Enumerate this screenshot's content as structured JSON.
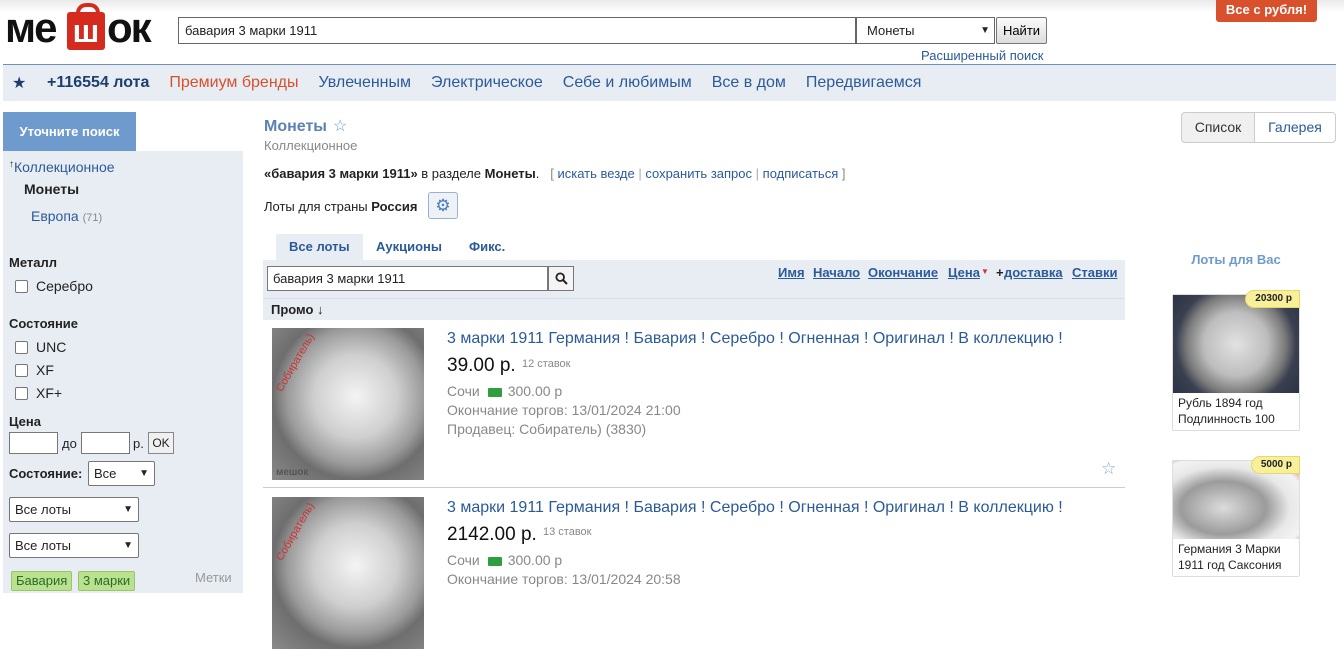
{
  "header": {
    "logo_left": "ме",
    "logo_bag": "ш",
    "logo_right": "ок",
    "search_value": "бавария 3 марки 1911",
    "category_selected": "Монеты",
    "search_button": "Найти",
    "advanced_search": "Расширенный поиск",
    "promo_badge": "Все с рубля!"
  },
  "nav": {
    "lot_count": "+116554 лота",
    "premium": "Премиум бренды",
    "items": [
      "Увлеченным",
      "Электрическое",
      "Себе и любимым",
      "Все в дом",
      "Передвигаемся"
    ]
  },
  "sidebar": {
    "refine": "Уточните поиск",
    "parent_link": "Коллекционное",
    "current": "Монеты",
    "sub_link": "Европа",
    "sub_count": "(71)",
    "metal_title": "Металл",
    "metal_silver": "Серебро",
    "condition_title": "Состояние",
    "conditions": [
      "UNC",
      "XF",
      "XF+"
    ],
    "price_title": "Цена",
    "price_to": "до",
    "price_unit": "р.",
    "price_ok": "OK",
    "condition_select_label": "Состояние:",
    "condition_select_value": "Все",
    "lots_select_1": "Все лоты",
    "lots_select_2": "Все лоты",
    "tags": [
      "Бавария",
      "3 марки"
    ],
    "tags_label": "Метки"
  },
  "main": {
    "title": "Монеты",
    "subtitle": "Коллекционное",
    "query_prefix": "«бавария 3 марки 1911»",
    "query_mid": " в разделе ",
    "query_section": "Монеты",
    "query_dot": ".",
    "links_open": "[",
    "link_everywhere": "искать везде",
    "sep": "|",
    "link_save": "сохранить запрос",
    "link_subscribe": "подписаться",
    "links_close": "]",
    "country_label": "Лоты для страны",
    "country": "Россия",
    "view_list": "Список",
    "view_gallery": "Галерея",
    "tabs": [
      "Все лоты",
      "Аукционы",
      "Фикс."
    ],
    "local_search": "бавария 3 марки 1911",
    "sort": {
      "name": "Имя",
      "start": "Начало",
      "end": "Окончание",
      "price": "Цена",
      "plus": "+",
      "delivery": "доставка",
      "bids": "Ставки"
    },
    "promo_row": "Промо ↓"
  },
  "lots": [
    {
      "title": "3 марки 1911 Германия ! Бавария ! Серебро ! Огненная ! Оригинал ! В коллекцию !",
      "price": "39.00 р.",
      "bids": "12 ставок",
      "city": "Сочи",
      "delivery": "300.00 р",
      "ends": "Окончание торгов: 13/01/2024 21:00",
      "seller": "Продавец: Собиратель) (3830)",
      "watermark": "Собиратель)",
      "logo": "мешок"
    },
    {
      "title": "3 марки 1911 Германия ! Бавария ! Серебро ! Огненная ! Оригинал ! В коллекцию !",
      "price": "2142.00 р.",
      "bids": "13 ставок",
      "city": "Сочи",
      "delivery": "300.00 р",
      "ends": "Окончание торгов: 13/01/2024 20:58",
      "watermark": "Собиратель)"
    }
  ],
  "right": {
    "title": "Лоты для Вас",
    "cards": [
      {
        "price": "20300 р",
        "caption": "Рубль 1894 год Подлинность 100"
      },
      {
        "price": "5000 р",
        "caption": "Германия 3 Марки 1911 год Саксония"
      }
    ]
  }
}
